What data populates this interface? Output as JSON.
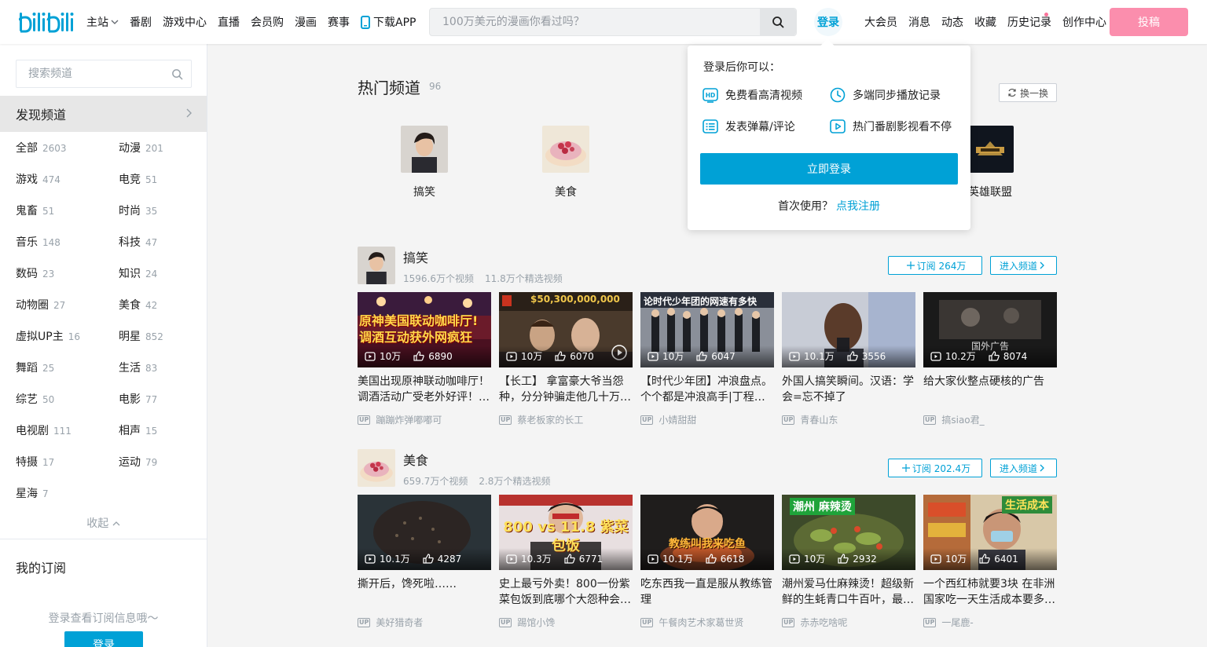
{
  "header": {
    "nav": [
      {
        "label": "主站",
        "name": "nav-main"
      },
      {
        "label": "番剧",
        "name": "nav-bangumi"
      },
      {
        "label": "游戏中心",
        "name": "nav-game-center"
      },
      {
        "label": "直播",
        "name": "nav-live"
      },
      {
        "label": "会员购",
        "name": "nav-mall"
      },
      {
        "label": "漫画",
        "name": "nav-manga"
      },
      {
        "label": "赛事",
        "name": "nav-match"
      }
    ],
    "download_label": "下载APP",
    "search_placeholder": "100万美元的漫画你看过吗？",
    "login_label": "登录",
    "right_nav": [
      "大会员",
      "消息",
      "动态",
      "收藏",
      "历史记录",
      "创作中心"
    ],
    "upload_label": "投稿",
    "colors": {
      "accent": "#00a1d6",
      "pink": "#fb7299"
    }
  },
  "sidebar": {
    "search_placeholder": "搜索频道",
    "discover_label": "发现频道",
    "categories": [
      {
        "name": "全部",
        "count": "2603"
      },
      {
        "name": "动漫",
        "count": "201"
      },
      {
        "name": "游戏",
        "count": "474"
      },
      {
        "name": "电竞",
        "count": "51"
      },
      {
        "name": "鬼畜",
        "count": "51"
      },
      {
        "name": "时尚",
        "count": "35"
      },
      {
        "name": "音乐",
        "count": "148"
      },
      {
        "name": "科技",
        "count": "47"
      },
      {
        "name": "数码",
        "count": "23"
      },
      {
        "name": "知识",
        "count": "24"
      },
      {
        "name": "动物圈",
        "count": "27"
      },
      {
        "name": "美食",
        "count": "42"
      },
      {
        "name": "虚拟UP主",
        "count": "16"
      },
      {
        "name": "明星",
        "count": "852"
      },
      {
        "name": "舞蹈",
        "count": "25"
      },
      {
        "name": "生活",
        "count": "83"
      },
      {
        "name": "综艺",
        "count": "50"
      },
      {
        "name": "电影",
        "count": "77"
      },
      {
        "name": "电视剧",
        "count": "111"
      },
      {
        "name": "相声",
        "count": "15"
      },
      {
        "name": "特摄",
        "count": "17"
      },
      {
        "name": "运动",
        "count": "79"
      },
      {
        "name": "星海",
        "count": "7"
      }
    ],
    "collapse_label": "收起",
    "my_sub_label": "我的订阅",
    "sub_hint": "登录查看订阅信息哦～",
    "login_label": "登录"
  },
  "hot": {
    "title": "热门频道",
    "count": "96",
    "refresh_label": "换一换",
    "channels": [
      "搞笑",
      "美食",
      "英雄联盟"
    ]
  },
  "sections": [
    {
      "name": "搞笑",
      "video_count": "1596.6万个视频",
      "featured_count": "11.8万个精选视频",
      "subscribe_label": "订阅 264万",
      "enter_label": "进入频道",
      "videos": [
        {
          "title": "美国出现原神联动咖啡厅！调酒活动广受老外好评！…",
          "views": "10万",
          "likes": "6890",
          "up": "蹦蹦炸弹嘟嘟可",
          "cover_text": "原神美国联动咖啡厅! 调酒互动获外网疯狂"
        },
        {
          "title": "【长工】 拿富豪大爷当怨种，分分钟骗走他几十万…",
          "views": "10万",
          "likes": "6070",
          "up": "蔡老板家的长工",
          "cover_text": "$50,300,000,000"
        },
        {
          "title": "【时代少年团】冲浪盘点。个个都是冲浪高手|丁程…",
          "views": "10万",
          "likes": "6047",
          "up": "小婧甜甜",
          "cover_text": "论时代少年团的网速有多快"
        },
        {
          "title": "外国人搞笑瞬间。汉语：学会=忘不掉了",
          "views": "10.1万",
          "likes": "3556",
          "up": "青春山东",
          "cover_text": ""
        },
        {
          "title": "给大家伙整点硬核的广告",
          "views": "10.2万",
          "likes": "8074",
          "up": "搞siao君_",
          "cover_text": "国外广告"
        }
      ]
    },
    {
      "name": "美食",
      "video_count": "659.7万个视频",
      "featured_count": "2.8万个精选视频",
      "subscribe_label": "订阅 202.4万",
      "enter_label": "进入频道",
      "videos": [
        {
          "title": "撕开后，馋死啦……",
          "views": "10.1万",
          "likes": "4287",
          "up": "美好猎奇者",
          "cover_text": ""
        },
        {
          "title": "史上最亏外卖！800一份紫菜包饭到底哪个大怨种会…",
          "views": "10.3万",
          "likes": "6771",
          "up": "踢馆小馋",
          "cover_text": "800 vs 11.8 紫菜包饭"
        },
        {
          "title": "吃东西我一直是服从教练管理",
          "views": "10.1万",
          "likes": "6618",
          "up": "午餐肉艺术家葛世贤",
          "cover_text": "教练叫我来吃鱼"
        },
        {
          "title": "潮州爱马仕麻辣烫！超级新鲜的生蚝青口牛百叶，最…",
          "views": "10万",
          "likes": "2932",
          "up": "赤赤吃啥呢",
          "cover_text": "潮州 麻辣烫"
        },
        {
          "title": "一个西红柿就要3块 在非洲国家吃一天生活成本要多…",
          "views": "10万",
          "likes": "6401",
          "up": "一尾鹿-",
          "cover_text": "生活成本"
        }
      ]
    }
  ],
  "popup": {
    "title": "登录后你可以：",
    "perks": [
      "免费看高清视频",
      "多端同步播放记录",
      "发表弹幕/评论",
      "热门番剧影视看不停"
    ],
    "login_label": "立即登录",
    "register_prompt": "首次使用？",
    "register_link": "点我注册"
  },
  "up_tag": "UP"
}
